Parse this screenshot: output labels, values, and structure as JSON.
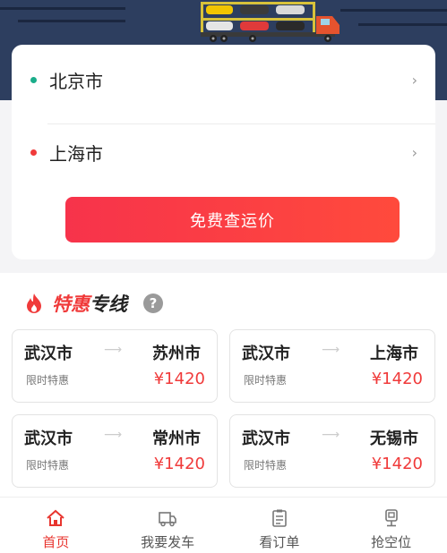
{
  "route": {
    "origin": "北京市",
    "destination": "上海市",
    "origin_dot_color": "#1aad8a",
    "destination_dot_color": "#f03a3a",
    "cta_label": "免费查运价"
  },
  "promo": {
    "title_accent": "特惠",
    "title_rest": "专线",
    "help_symbol": "?",
    "deals": [
      {
        "from": "武汉市",
        "to": "苏州市",
        "tag": "限时特惠",
        "price": "¥1420"
      },
      {
        "from": "武汉市",
        "to": "上海市",
        "tag": "限时特惠",
        "price": "¥1420"
      },
      {
        "from": "武汉市",
        "to": "常州市",
        "tag": "限时特惠",
        "price": "¥1420"
      },
      {
        "from": "武汉市",
        "to": "无锡市",
        "tag": "限时特惠",
        "price": "¥1420"
      }
    ]
  },
  "tabbar": {
    "items": [
      {
        "label": "首页",
        "icon": "home-icon",
        "active": true
      },
      {
        "label": "我要发车",
        "icon": "truck-icon",
        "active": false
      },
      {
        "label": "看订单",
        "icon": "clipboard-icon",
        "active": false
      },
      {
        "label": "抢空位",
        "icon": "seat-icon",
        "active": false
      }
    ]
  },
  "colors": {
    "accent": "#f03a3a",
    "hero_bg": "#2d3e5f"
  }
}
